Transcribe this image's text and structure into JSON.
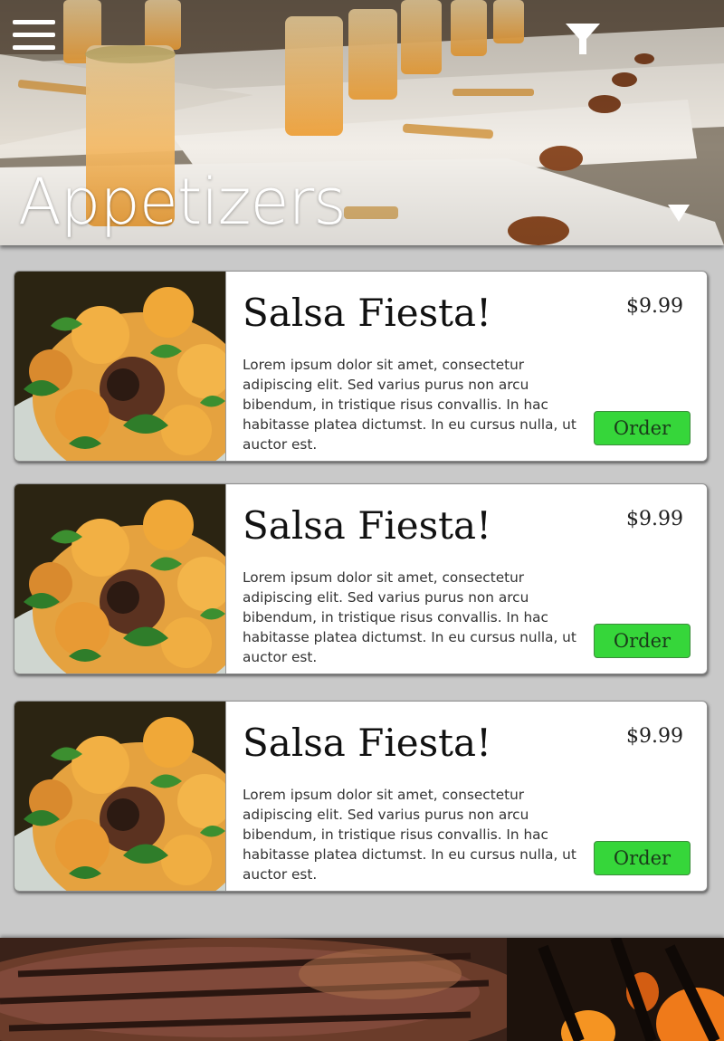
{
  "header": {
    "title": "Appetizers",
    "menu_icon": "hamburger-icon",
    "filter_icon": "filter-icon",
    "dropdown_icon": "caret-down-icon"
  },
  "menu_items": [
    {
      "name": "Salsa Fiesta!",
      "price": "$9.99",
      "description": "Lorem ipsum dolor sit amet, consectetur adipiscing elit. Sed varius purus non arcu bibendum, in tristique risus convallis. In hac habitasse platea dictumst. In eu cursus nulla, ut auctor est.",
      "order_label": "Order"
    },
    {
      "name": "Salsa Fiesta!",
      "price": "$9.99",
      "description": "Lorem ipsum dolor sit amet, consectetur adipiscing elit. Sed varius purus non arcu bibendum, in tristique risus convallis. In hac habitasse platea dictumst. In eu cursus nulla, ut auctor est.",
      "order_label": "Order"
    },
    {
      "name": "Salsa Fiesta!",
      "price": "$9.99",
      "description": "Lorem ipsum dolor sit amet, consectetur adipiscing elit. Sed varius purus non arcu bibendum, in tristique risus convallis. In hac habitasse platea dictumst. In eu cursus nulla, ut auctor est.",
      "order_label": "Order"
    }
  ],
  "colors": {
    "background": "#c9c9c9",
    "card": "#ffffff",
    "order_button": "#36d63a"
  }
}
